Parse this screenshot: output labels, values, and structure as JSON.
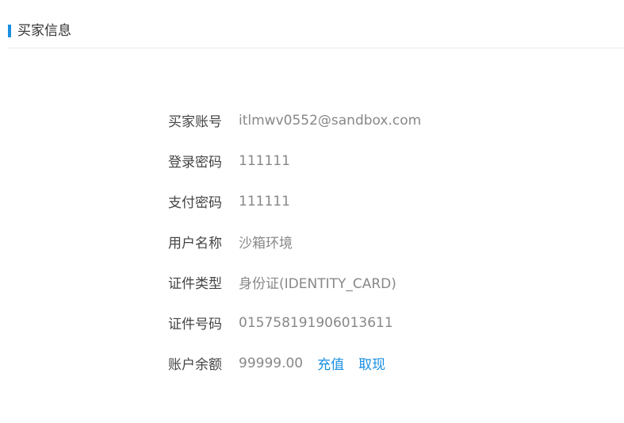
{
  "section": {
    "title": "买家信息"
  },
  "colors": {
    "accent": "#1a8fe0",
    "label": "#444444",
    "value": "#888888",
    "divider": "#ececec"
  },
  "buyer": {
    "account": {
      "label": "买家账号",
      "value": "itlmwv0552@sandbox.com"
    },
    "login_password": {
      "label": "登录密码",
      "value": "111111"
    },
    "pay_password": {
      "label": "支付密码",
      "value": "111111"
    },
    "username": {
      "label": "用户名称",
      "value": "沙箱环境"
    },
    "id_type": {
      "label": "证件类型",
      "value": "身份证(IDENTITY_CARD)"
    },
    "id_number": {
      "label": "证件号码",
      "value": "015758191906013611"
    },
    "balance": {
      "label": "账户余额",
      "value": "99999.00",
      "recharge_label": "充值",
      "withdraw_label": "取现"
    }
  }
}
